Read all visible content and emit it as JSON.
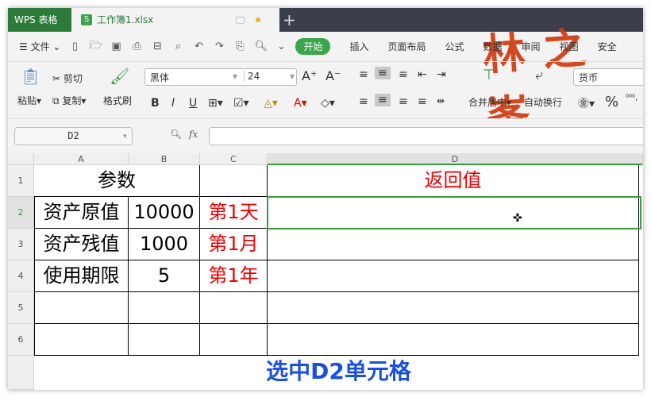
{
  "tabs": {
    "app": "WPS 表格",
    "doc": "工作簿1.xlsx",
    "doc_icon": "S",
    "new": "+"
  },
  "toolbar": {
    "file": "文件",
    "start": "开始",
    "menus": [
      "插入",
      "页面布局",
      "公式",
      "数据",
      "审阅",
      "视图",
      "安全"
    ]
  },
  "ribbon": {
    "paste": "粘贴",
    "cut": "剪切",
    "copy": "复制",
    "format_painter": "格式刷",
    "font": "黑体",
    "size": "24",
    "merge": "合并居中",
    "wrap": "自动换行",
    "number_format": "货币",
    "bold": "B",
    "italic": "I",
    "underline": "U",
    "percent": "%"
  },
  "formula": {
    "name_box": "D2",
    "fx": "fx",
    "value": ""
  },
  "columns": [
    "A",
    "B",
    "C",
    "D"
  ],
  "rows": [
    "1",
    "2",
    "3",
    "4",
    "5",
    "6"
  ],
  "cells": {
    "a1": "参数",
    "d1": "返回值",
    "a2": "资产原值",
    "b2": "10000",
    "c2": "第1天",
    "a3": "资产残值",
    "b3": "1000",
    "c3": "第1月",
    "a4": "使用期限",
    "b4": "5",
    "c4": "第1年"
  },
  "caption": "选中D2单元格",
  "watermark": "林之峯",
  "colors": {
    "accent": "#2d7a3a",
    "red": "#ee0000",
    "caption": "#1a4fe0"
  }
}
